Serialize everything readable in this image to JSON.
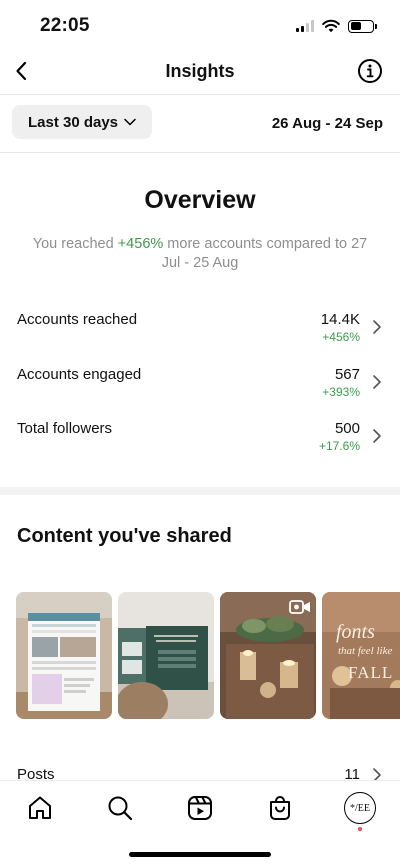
{
  "status": {
    "time": "22:05"
  },
  "header": {
    "title": "Insights"
  },
  "filters": {
    "range_label": "Last 30 days",
    "date_range": "26 Aug - 24 Sep"
  },
  "overview": {
    "title": "Overview",
    "desc_prefix": "You reached ",
    "desc_highlight": "+456%",
    "desc_suffix": " more accounts compared to 27 Jul - 25 Aug"
  },
  "metrics": [
    {
      "label": "Accounts reached",
      "value": "14.4K",
      "change": "+456%"
    },
    {
      "label": "Accounts engaged",
      "value": "567",
      "change": "+393%"
    },
    {
      "label": "Total followers",
      "value": "500",
      "change": "+17.6%"
    }
  ],
  "content": {
    "title": "Content you've shared",
    "thumbnails": [
      {
        "name": "website-screenshot-post",
        "caption": "WELCOME TO",
        "badge": ""
      },
      {
        "name": "conversions-post",
        "caption": "10 Ways to Increase Conversions",
        "badge": ""
      },
      {
        "name": "candles-reel",
        "caption": "",
        "badge": "reel-icon"
      },
      {
        "name": "fonts-fall-post",
        "caption": "fonts that feel like FALL",
        "badge": ""
      }
    ],
    "posts_label": "Posts",
    "posts_count": "11"
  },
  "tabs": {
    "home": "home-icon",
    "search": "search-icon",
    "reels": "reels-icon",
    "shop": "shop-icon",
    "profile": "profile-avatar",
    "avatar_text": "*/EE"
  },
  "colors": {
    "positive": "#3e9a4b",
    "muted": "#8e8e8e",
    "notification_dot": "#ed4956"
  }
}
